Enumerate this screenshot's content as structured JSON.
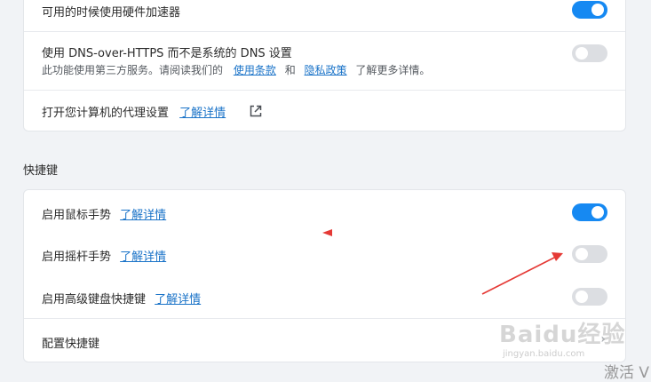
{
  "card1": {
    "row_hw": {
      "label": "可用的时候使用硬件加速器",
      "toggle_on": true
    },
    "row_dns": {
      "label": "使用 DNS-over-HTTPS 而不是系统的 DNS 设置",
      "sub_prefix": "此功能使用第三方服务。请阅读我们的",
      "terms_link": "使用条款",
      "and_text": "和",
      "privacy_link": "隐私政策",
      "sub_suffix": "了解更多详情。",
      "toggle_on": false
    },
    "row_proxy": {
      "label": "打开您计算机的代理设置",
      "link": "了解详情"
    }
  },
  "section_shortcuts": {
    "title": "快捷键",
    "rows": [
      {
        "label": "启用鼠标手势",
        "link": "了解详情",
        "toggle_on": true
      },
      {
        "label": "启用摇杆手势",
        "link": "了解详情",
        "toggle_on": false
      },
      {
        "label": "启用高级键盘快捷键",
        "link": "了解详情",
        "toggle_on": false
      },
      {
        "label": "配置快捷键",
        "chevron": "›"
      }
    ]
  },
  "watermark": {
    "main": "Baidu经验",
    "sub": "jingyan.baidu.com"
  },
  "os_overlay": {
    "activate": "激活 V"
  },
  "colors": {
    "accent": "#1689f2",
    "link": "#1a73c8",
    "annotation_red": "#e53935"
  }
}
